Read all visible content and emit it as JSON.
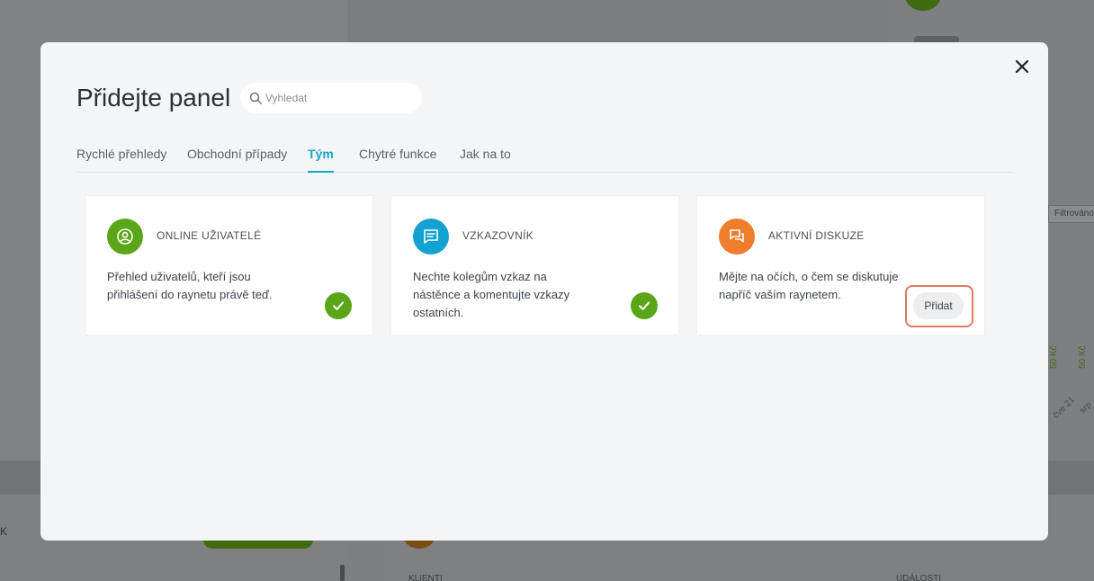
{
  "background": {
    "filter_label": "Filtrováno",
    "bar_value_1": "50 Kč",
    "bar_value_2": "50 Kč",
    "date_1": "čve 21",
    "date_2": "srp",
    "left_label": "K",
    "clients_label": "KLIENTI",
    "events_label": "UDÁLOSTI"
  },
  "modal": {
    "title": "Přidejte panel",
    "search_placeholder": "Vyhledat",
    "tabs": [
      {
        "label": "Rychlé přehledy",
        "active": false
      },
      {
        "label": "Obchodní případy",
        "active": false
      },
      {
        "label": "Tým",
        "active": true
      },
      {
        "label": "Chytré funkce",
        "active": false
      },
      {
        "label": "Jak na to",
        "active": false
      }
    ],
    "cards": [
      {
        "icon": "user-circle-icon",
        "icon_color": "#5ba518",
        "title": "ONLINE UŽIVATELÉ",
        "description": "Přehled uživatelů, kteří jsou přihlášení do raynetu právě teď.",
        "state": "added"
      },
      {
        "icon": "message-board-icon",
        "icon_color": "#13a2cf",
        "title": "VZKAZOVNÍK",
        "description": "Nechte kolegům vzkaz na nástěnce a komentujte vzkazy ostatních.",
        "state": "added"
      },
      {
        "icon": "discussion-icon",
        "icon_color": "#f07d2b",
        "title": "AKTIVNÍ DISKUZE",
        "description": "Mějte na očích, o čem se diskutuje napříč vaším raynetem.",
        "state": "available",
        "add_label": "Přidat"
      }
    ]
  }
}
